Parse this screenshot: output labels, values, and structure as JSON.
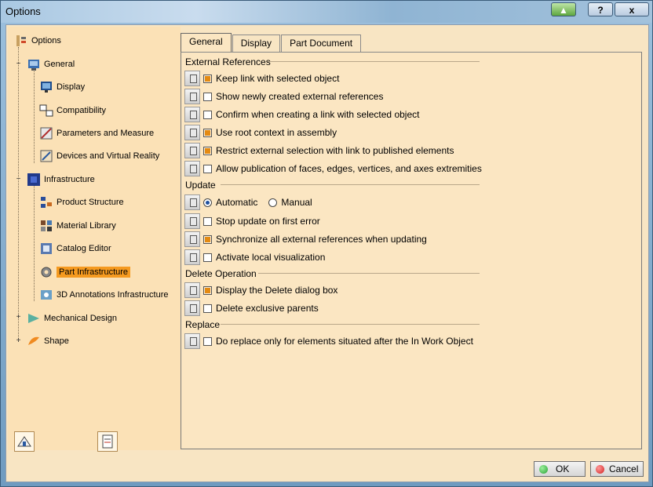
{
  "window": {
    "title": "Options",
    "help_label": "?",
    "close_label": "x"
  },
  "tree": {
    "root": "Options",
    "items": [
      {
        "label": "General"
      },
      {
        "label": "Display"
      },
      {
        "label": "Compatibility"
      },
      {
        "label": "Parameters and Measure"
      },
      {
        "label": "Devices and Virtual Reality"
      },
      {
        "label": "Infrastructure"
      },
      {
        "label": "Product Structure"
      },
      {
        "label": "Material Library"
      },
      {
        "label": "Catalog Editor"
      },
      {
        "label": "Part Infrastructure"
      },
      {
        "label": "3D Annotations Infrastructure"
      },
      {
        "label": "Mechanical Design"
      },
      {
        "label": "Shape"
      }
    ]
  },
  "tabs": [
    {
      "label": "General",
      "active": true
    },
    {
      "label": "Display",
      "active": false
    },
    {
      "label": "Part Document",
      "active": false
    }
  ],
  "sections": {
    "external_references": {
      "title": "External References",
      "options": [
        {
          "label": "Keep link with selected object",
          "checked": true
        },
        {
          "label": "Show newly created external references",
          "checked": false
        },
        {
          "label": "Confirm when creating a link with selected object",
          "checked": false
        },
        {
          "label": "Use root context in assembly",
          "checked": true
        },
        {
          "label": "Restrict external selection with link to published elements",
          "checked": true
        },
        {
          "label": "Allow publication of faces, edges, vertices, and axes extremities",
          "checked": false
        }
      ]
    },
    "update": {
      "title": "Update",
      "mode_auto": "Automatic",
      "mode_manual": "Manual",
      "selected_mode": "Automatic",
      "options": [
        {
          "label": "Stop update on first error",
          "checked": false
        },
        {
          "label": "Synchronize all external references when updating",
          "checked": true
        },
        {
          "label": "Activate local visualization",
          "checked": false
        }
      ]
    },
    "delete_operation": {
      "title": "Delete Operation",
      "options": [
        {
          "label": "Display the Delete dialog box",
          "checked": true
        },
        {
          "label": "Delete exclusive parents",
          "checked": false
        }
      ]
    },
    "replace": {
      "title": "Replace",
      "options": [
        {
          "label": "Do replace only for elements situated after the In Work Object",
          "checked": false
        }
      ]
    }
  },
  "buttons": {
    "ok": "OK",
    "cancel": "Cancel"
  },
  "colors": {
    "selection": "#f59a20",
    "panel_bg": "#fbe6c2",
    "check_fill": "#e48a12",
    "ok_dot": "#27a234",
    "cancel_dot": "#d32020"
  }
}
